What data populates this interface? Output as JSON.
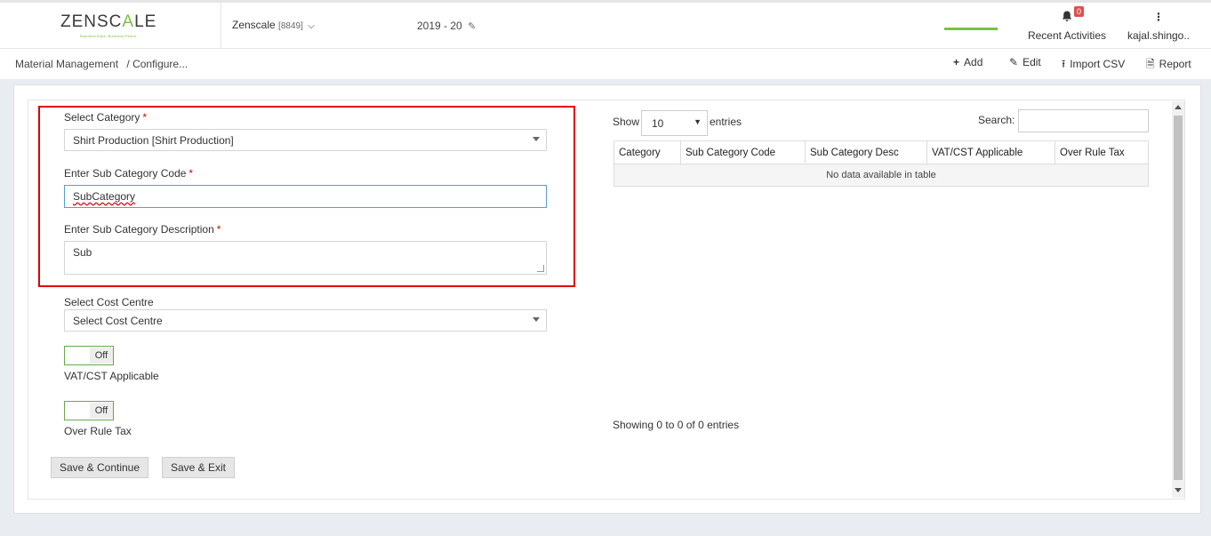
{
  "header": {
    "logo_prefix": "ZENSC",
    "logo_highlight": "A",
    "logo_suffix": "LE",
    "logo_tagline": "Business Ease. Business Peace.",
    "company_name": "Zenscale",
    "company_code": "[8849]",
    "fiscal_year": "2019 - 20",
    "notifications_count": "0",
    "activities_label": "Recent Activities",
    "user_name": "kajal.shingo.."
  },
  "breadcrumb": {
    "root": "Material Management",
    "current": "/ Configure..."
  },
  "toolbar": {
    "add_label": "Add",
    "edit_label": "Edit",
    "import_label": "Import CSV",
    "report_label": "Report",
    "active": "Add"
  },
  "form": {
    "category_label": "Select Category",
    "category_value": "Shirt Production [Shirt Production]",
    "subcode_label": "Enter Sub Category Code",
    "subcode_value": "SubCategory",
    "subdesc_label": "Enter Sub Category Description",
    "subdesc_value": "Sub",
    "costcentre_label": "Select Cost Centre",
    "costcentre_value": "Select Cost Centre",
    "required_mark": "*",
    "vat_toggle_state": "Off",
    "vat_label": "VAT/CST Applicable",
    "overrule_toggle_state": "Off",
    "overrule_label": "Over Rule Tax",
    "save_continue_label": "Save & Continue",
    "save_exit_label": "Save & Exit"
  },
  "table": {
    "show_label": "Show",
    "page_length": "10",
    "entries_label": "entries",
    "search_label": "Search:",
    "search_value": "",
    "columns": [
      "Category",
      "Sub Category Code",
      "Sub Category Desc",
      "VAT/CST Applicable",
      "Over Rule Tax"
    ],
    "empty_message": "No data available in table",
    "info": "Showing 0 to 0 of 0 entries"
  },
  "colors": {
    "brand_green": "#7cc043",
    "highlight_red": "#e00000",
    "badge_red": "#d9534f"
  }
}
